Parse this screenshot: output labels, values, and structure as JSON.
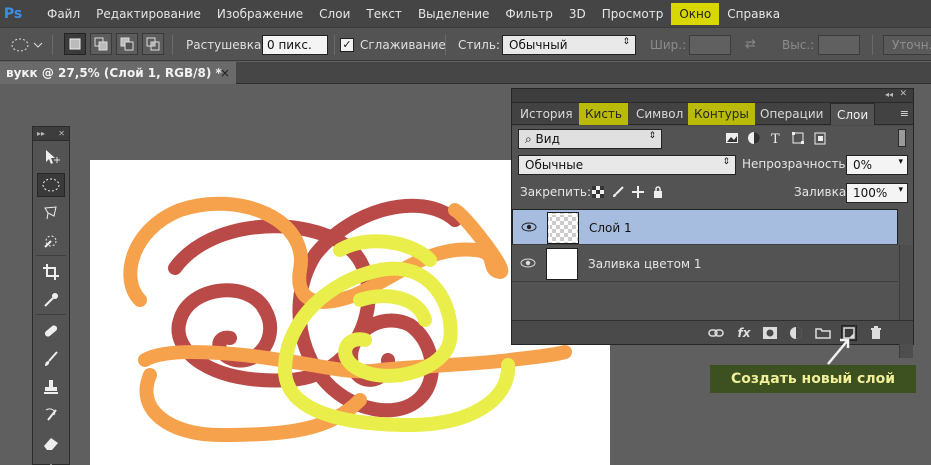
{
  "app": {
    "logo": "Ps"
  },
  "menu": [
    "Файл",
    "Редактирование",
    "Изображение",
    "Слои",
    "Текст",
    "Выделение",
    "Фильтр",
    "3D",
    "Просмотр",
    "Окно",
    "Справка"
  ],
  "options": {
    "feather_label": "Растушевка:",
    "feather_value": "0 пикс.",
    "antialias_label": "Сглаживание",
    "antialias_checked": "✓",
    "style_label": "Стиль:",
    "style_value": "Обычный",
    "width_label": "Шир.:",
    "height_label": "Выс.:",
    "refine_label": "Уточн."
  },
  "document": {
    "tab_title": "вукк @ 27,5% (Слой 1, RGB/8) *",
    "close": "×"
  },
  "panel": {
    "tabs": [
      "История",
      "Кисть",
      "Символ",
      "Контуры",
      "Операции",
      "Слои"
    ],
    "filter_label": "Вид",
    "blend_mode": "Обычные",
    "opacity_label": "Непрозрачность:",
    "opacity_value": "0%",
    "lock_label": "Закрепить:",
    "fill_label": "Заливка:",
    "fill_value": "100%",
    "layers": [
      {
        "name": "Слой 1",
        "selected": true
      },
      {
        "name": "Заливка цветом 1",
        "selected": false
      }
    ]
  },
  "callout": {
    "text": "Создать новый слой"
  },
  "colors": {
    "highlight": "#d8d800",
    "selected_layer": "#a7bddf",
    "callout_bg": "#3c5020",
    "stroke_red": "#b94a48",
    "stroke_orange": "#f6a24c",
    "stroke_yellow": "#e9ee4a"
  }
}
